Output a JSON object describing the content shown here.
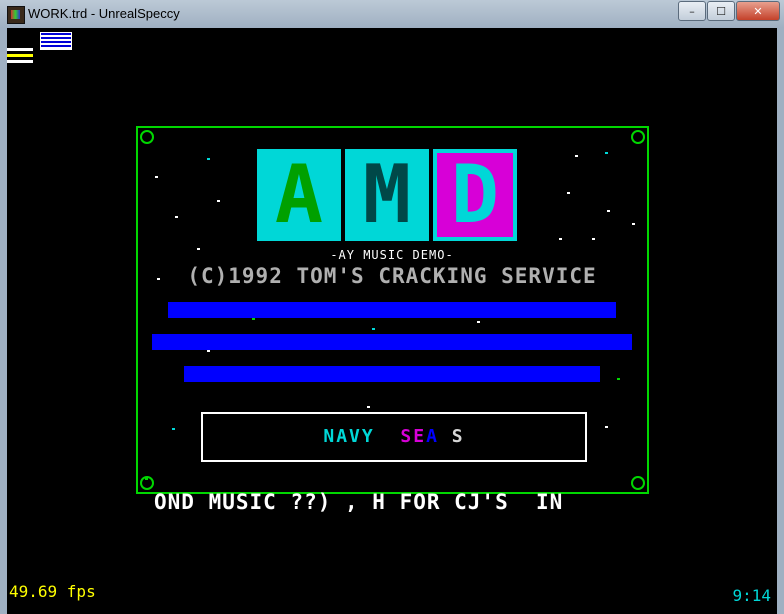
{
  "window": {
    "title": "WORK.trd - UnrealSpeccy",
    "minimize_label": "–",
    "maximize_label": "☐",
    "close_label": "✕"
  },
  "screen": {
    "subtitle": "-AY MUSIC DEMO-",
    "copyright": "(C)1992 TOM'S CRACKING SERVICE",
    "logo_letters": [
      "A",
      "M",
      "D"
    ],
    "name_box": {
      "parts": [
        "NAVY",
        "SE",
        "A",
        "S"
      ]
    },
    "scroller": "OND MUSIC ??) , H FOR CJ'S  IN",
    "fps": "49.69 fps",
    "clock": "9:14"
  },
  "colors": {
    "border": "#00d700",
    "bar": "#0000ff",
    "cyan": "#00d7d7",
    "magenta": "#d700d7",
    "yellow": "#d7d700"
  }
}
